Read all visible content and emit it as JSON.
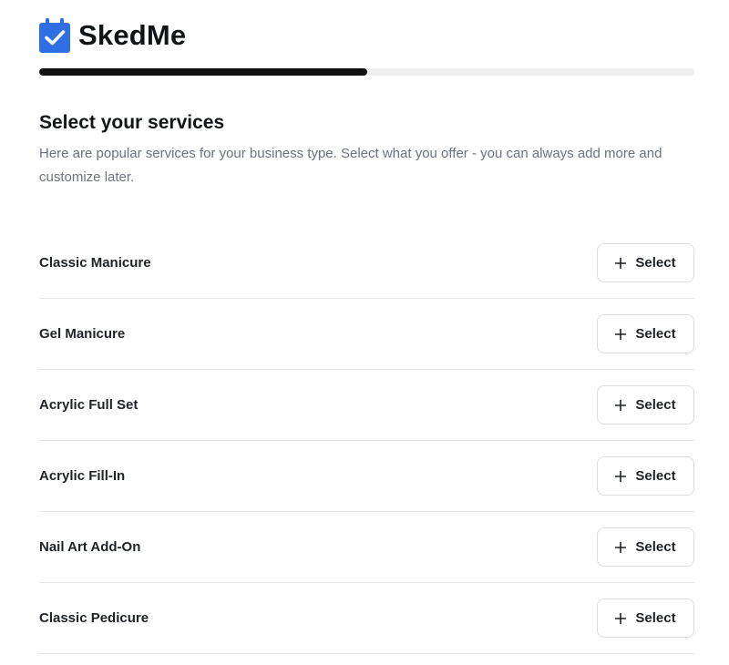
{
  "brand": {
    "name": "SkedMe",
    "logo_icon": "calendar-check-icon",
    "logo_color": "#2f6fe4"
  },
  "progress": {
    "fraction": 0.5,
    "track_color": "#efefef",
    "fill_color": "#111111"
  },
  "page": {
    "title": "Select your services",
    "subtitle": "Here are popular services for your business type. Select what you offer - you can always add more and customize later."
  },
  "services": [
    {
      "name": "Classic Manicure",
      "button_label": "Select",
      "button_icon": "plus-icon"
    },
    {
      "name": "Gel Manicure",
      "button_label": "Select",
      "button_icon": "plus-icon"
    },
    {
      "name": "Acrylic Full Set",
      "button_label": "Select",
      "button_icon": "plus-icon"
    },
    {
      "name": "Acrylic Fill-In",
      "button_label": "Select",
      "button_icon": "plus-icon"
    },
    {
      "name": "Nail Art Add-On",
      "button_label": "Select",
      "button_icon": "plus-icon"
    },
    {
      "name": "Classic Pedicure",
      "button_label": "Select",
      "button_icon": "plus-icon"
    }
  ]
}
